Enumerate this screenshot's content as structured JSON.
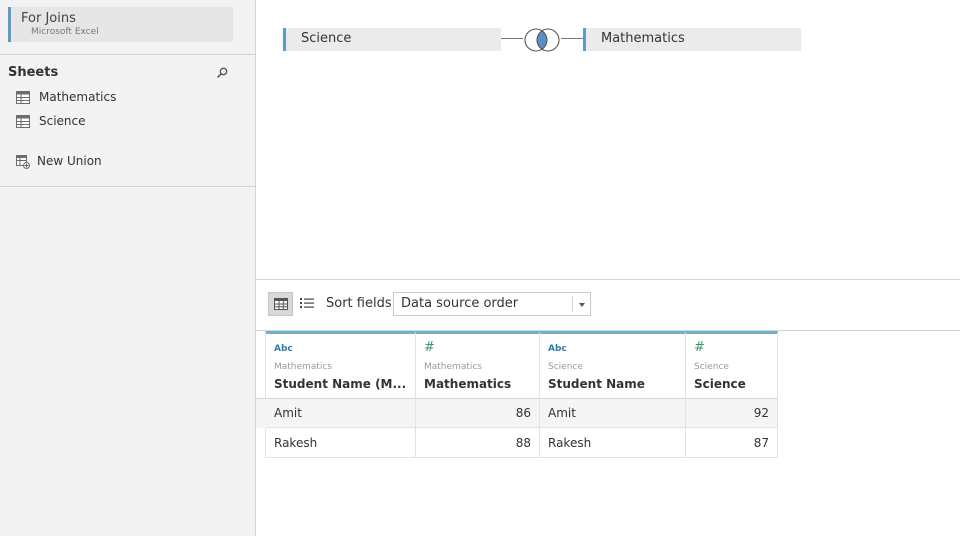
{
  "connection": {
    "name": "For Joins",
    "type": "Microsoft Excel"
  },
  "sidebar": {
    "title": "Sheets",
    "search_icon": "search-icon",
    "items": [
      {
        "label": "Mathematics",
        "icon": "sheet-table-icon"
      },
      {
        "label": "Science",
        "icon": "sheet-table-icon"
      },
      {
        "label": "New Union",
        "icon": "new-union-icon"
      }
    ]
  },
  "join": {
    "left_table": "Science",
    "right_table": "Mathematics",
    "type_icon": "inner-join-icon",
    "color_fill": "#5a8fc2"
  },
  "toolbar": {
    "grid_view_icon": "grid-view-icon",
    "list_view_icon": "list-view-icon",
    "sort_label": "Sort fields",
    "sort_value": "Data source order"
  },
  "grid": {
    "columns": [
      {
        "type_label": "Abc",
        "source": "Mathematics",
        "name": "Student Name (M..."
      },
      {
        "type_label": "#",
        "source": "Mathematics",
        "name": "Mathematics"
      },
      {
        "type_label": "Abc",
        "source": "Science",
        "name": "Student Name"
      },
      {
        "type_label": "#",
        "source": "Science",
        "name": "Science"
      }
    ],
    "rows": [
      [
        "Amit",
        "86",
        "Amit",
        "92"
      ],
      [
        "Rakesh",
        "88",
        "Rakesh",
        "87"
      ]
    ]
  },
  "colors": {
    "accent": "#5b9ec4",
    "header_accent": "#6fb0cf",
    "string_type": "#2e7da8",
    "number_type": "#3c9a6a"
  }
}
